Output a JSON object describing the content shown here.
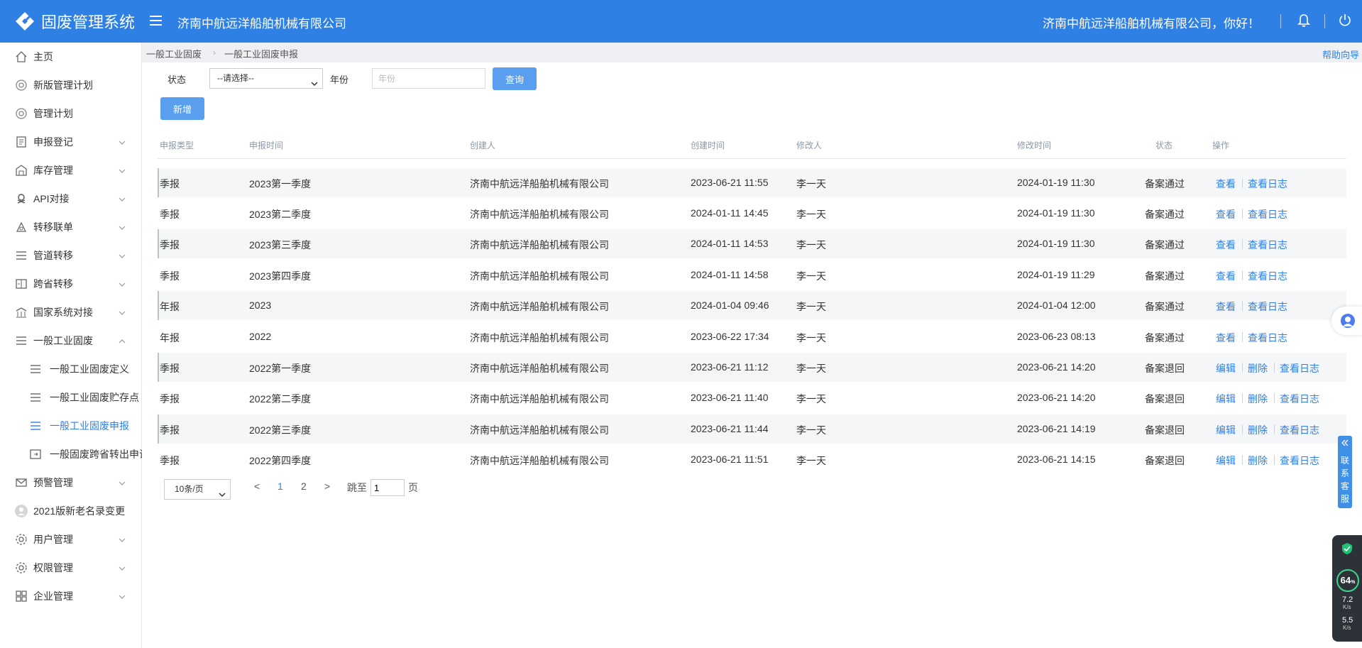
{
  "header": {
    "app_title": "固废管理系统",
    "company": "济南中航远洋船舶机械有限公司",
    "greeting": "济南中航远洋船舶机械有限公司，你好！"
  },
  "sidebar": {
    "items": [
      {
        "label": "主页",
        "icon": "home-icon"
      },
      {
        "label": "新版管理计划",
        "icon": "plan-icon"
      },
      {
        "label": "管理计划",
        "icon": "plan-icon"
      },
      {
        "label": "申报登记",
        "icon": "form-icon"
      },
      {
        "label": "库存管理",
        "icon": "warehouse-icon"
      },
      {
        "label": "API对接",
        "icon": "api-icon"
      },
      {
        "label": "转移联单",
        "icon": "transfer-icon"
      },
      {
        "label": "管道转移",
        "icon": "list-icon"
      },
      {
        "label": "跨省转移",
        "icon": "cross-province-icon"
      },
      {
        "label": "国家系统对接",
        "icon": "building-icon"
      },
      {
        "label": "一般工业固废",
        "icon": "list-icon"
      },
      {
        "label": "一般工业固废定义",
        "icon": "list-icon"
      },
      {
        "label": "一般工业固废贮存点",
        "icon": "list-icon"
      },
      {
        "label": "一般工业固废申报",
        "icon": "list-icon"
      },
      {
        "label": "一般固废跨省转出申请",
        "icon": "export-icon"
      },
      {
        "label": "预警管理",
        "icon": "mail-icon"
      },
      {
        "label": "2021版新老名录变更",
        "icon": "avatar-icon"
      },
      {
        "label": "用户管理",
        "icon": "gear-icon"
      },
      {
        "label": "权限管理",
        "icon": "gear-icon"
      },
      {
        "label": "企业管理",
        "icon": "grid-icon"
      }
    ]
  },
  "breadcrumb": {
    "items": [
      "一般工业固废",
      "一般工业固废申报"
    ],
    "help": "帮助向导"
  },
  "filters": {
    "status_label": "状态",
    "status_value": "--请选择--",
    "year_label": "年份",
    "year_placeholder": "年份",
    "query_button": "查询",
    "add_button": "新增"
  },
  "table": {
    "headers": [
      "申报类型",
      "申报时间",
      "创建人",
      "创建时间",
      "修改人",
      "修改时间",
      "状态",
      "操作"
    ],
    "rows": [
      {
        "type": "季报",
        "period": "2023第一季度",
        "creator": "济南中航远洋船舶机械有限公司",
        "created": "2023-06-21 11:55",
        "modifier": "李一天",
        "modified": "2024-01-19 11:30",
        "status": "备案通过",
        "actions": [
          "查看",
          "查看日志"
        ]
      },
      {
        "type": "季报",
        "period": "2023第二季度",
        "creator": "济南中航远洋船舶机械有限公司",
        "created": "2024-01-11 14:45",
        "modifier": "李一天",
        "modified": "2024-01-19 11:30",
        "status": "备案通过",
        "actions": [
          "查看",
          "查看日志"
        ]
      },
      {
        "type": "季报",
        "period": "2023第三季度",
        "creator": "济南中航远洋船舶机械有限公司",
        "created": "2024-01-11 14:53",
        "modifier": "李一天",
        "modified": "2024-01-19 11:30",
        "status": "备案通过",
        "actions": [
          "查看",
          "查看日志"
        ]
      },
      {
        "type": "季报",
        "period": "2023第四季度",
        "creator": "济南中航远洋船舶机械有限公司",
        "created": "2024-01-11 14:58",
        "modifier": "李一天",
        "modified": "2024-01-19 11:29",
        "status": "备案通过",
        "actions": [
          "查看",
          "查看日志"
        ]
      },
      {
        "type": "年报",
        "period": "2023",
        "creator": "济南中航远洋船舶机械有限公司",
        "created": "2024-01-04 09:46",
        "modifier": "李一天",
        "modified": "2024-01-04 12:00",
        "status": "备案通过",
        "actions": [
          "查看",
          "查看日志"
        ]
      },
      {
        "type": "年报",
        "period": "2022",
        "creator": "济南中航远洋船舶机械有限公司",
        "created": "2023-06-22 17:34",
        "modifier": "李一天",
        "modified": "2023-06-23 08:13",
        "status": "备案通过",
        "actions": [
          "查看",
          "查看日志"
        ]
      },
      {
        "type": "季报",
        "period": "2022第一季度",
        "creator": "济南中航远洋船舶机械有限公司",
        "created": "2023-06-21 11:12",
        "modifier": "李一天",
        "modified": "2023-06-21 14:20",
        "status": "备案退回",
        "actions": [
          "编辑",
          "删除",
          "查看日志"
        ]
      },
      {
        "type": "季报",
        "period": "2022第二季度",
        "creator": "济南中航远洋船舶机械有限公司",
        "created": "2023-06-21 11:40",
        "modifier": "李一天",
        "modified": "2023-06-21 14:20",
        "status": "备案退回",
        "actions": [
          "编辑",
          "删除",
          "查看日志"
        ]
      },
      {
        "type": "季报",
        "period": "2022第三季度",
        "creator": "济南中航远洋船舶机械有限公司",
        "created": "2023-06-21 11:44",
        "modifier": "李一天",
        "modified": "2023-06-21 14:19",
        "status": "备案退回",
        "actions": [
          "编辑",
          "删除",
          "查看日志"
        ]
      },
      {
        "type": "季报",
        "period": "2022第四季度",
        "creator": "济南中航远洋船舶机械有限公司",
        "created": "2023-06-21 11:51",
        "modifier": "李一天",
        "modified": "2023-06-21 14:15",
        "status": "备案退回",
        "actions": [
          "编辑",
          "删除",
          "查看日志"
        ]
      }
    ]
  },
  "pagination": {
    "page_size": "10条/页",
    "prev": "<",
    "pages": [
      "1",
      "2"
    ],
    "current": "1",
    "next": ">",
    "jump_label": "跳至",
    "jump_value": "1",
    "page_suffix": "页"
  },
  "float_widget": {
    "customer_service": "联系客服",
    "percent": "64",
    "percent_unit": "%",
    "upload_speed": "7.2",
    "download_speed": "5.5",
    "speed_unit": "K/s"
  },
  "colors": {
    "primary": "#2f80e4",
    "button": "#5a9ef0",
    "row_alt": "#f5f6f8"
  }
}
